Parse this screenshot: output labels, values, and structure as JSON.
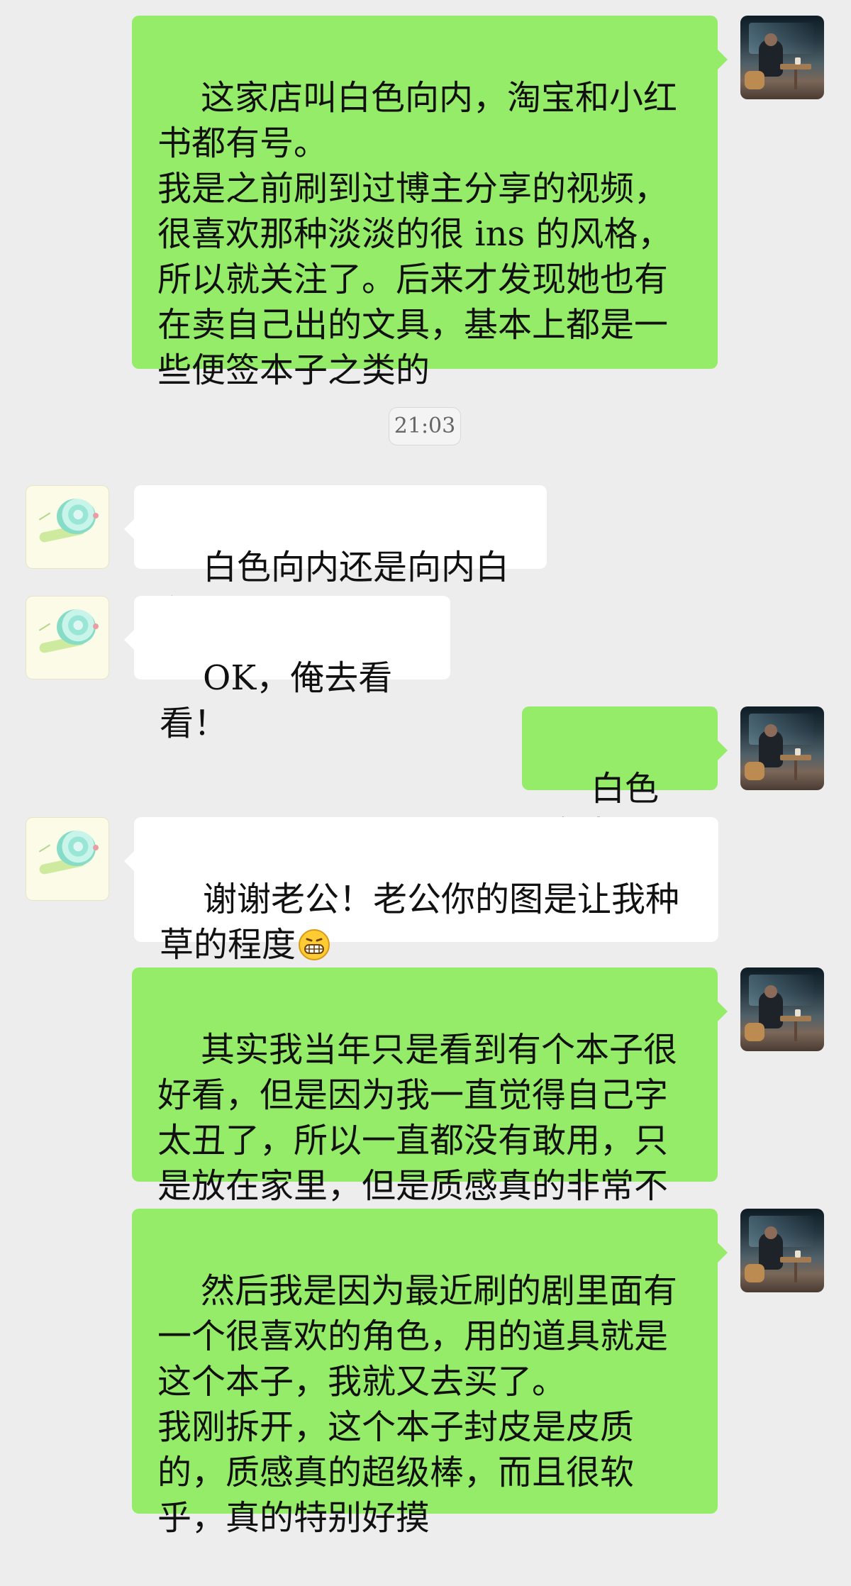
{
  "chat": {
    "messages": [
      {
        "sender": "self",
        "text": "这家店叫白色向内，淘宝和小红书都有号。\n我是之前刷到过博主分享的视频，很喜欢那种淡淡的很 ins 的风格，所以就关注了。后来才发现她也有在卖自己出的文具，基本上都是一些便签本子之类的"
      },
      {
        "timestamp": "21:03"
      },
      {
        "sender": "contact",
        "text": "白色向内还是向内白色"
      },
      {
        "sender": "contact",
        "text": "OK，俺去看看！"
      },
      {
        "sender": "self",
        "text": "白色向内"
      },
      {
        "sender": "contact",
        "text": "谢谢老公！老公你的图是让我种草的程度",
        "emoji": "grinning-face-icon"
      },
      {
        "sender": "self",
        "text": "其实我当年只是看到有个本子很好看，但是因为我一直觉得自己字太丑了，所以一直都没有敢用，只是放在家里，但是质感真的非常不错"
      },
      {
        "sender": "self",
        "text": "然后我是因为最近刷的剧里面有一个很喜欢的角色，用的道具就是这个本子，我就又去买了。\n我刚拆开，这个本子封皮是皮质的，质感真的超级棒，而且很软乎，真的特别好摸"
      }
    ]
  },
  "colors": {
    "background": "#ededed",
    "self_bubble": "#95ec69",
    "contact_bubble": "#ffffff",
    "text": "#111111",
    "timestamp_text": "#666666"
  }
}
